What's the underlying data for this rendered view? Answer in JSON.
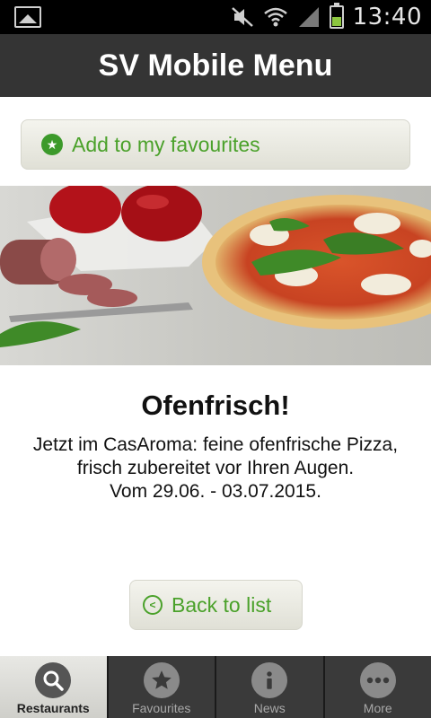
{
  "status_bar": {
    "time": "13:40"
  },
  "header": {
    "title": "SV Mobile Menu"
  },
  "favourite_button": {
    "label": "Add to my favourites"
  },
  "article": {
    "title": "Ofenfrisch!",
    "lines": [
      "Jetzt im CasAroma: feine ofenfrische Pizza,",
      "frisch zubereitet vor Ihren Augen.",
      "Vom 29.06. - 03.07.2015."
    ]
  },
  "back_button": {
    "label": "Back to list"
  },
  "tabs": [
    {
      "label": "Restaurants",
      "icon": "search-icon",
      "active": true
    },
    {
      "label": "Favourites",
      "icon": "star-icon",
      "active": false
    },
    {
      "label": "News",
      "icon": "info-icon",
      "active": false
    },
    {
      "label": "More",
      "icon": "more-icon",
      "active": false
    }
  ],
  "colors": {
    "accent_green": "#4aa12a",
    "header_bg": "#343434",
    "tabbar_bg": "#3a3a3a"
  }
}
